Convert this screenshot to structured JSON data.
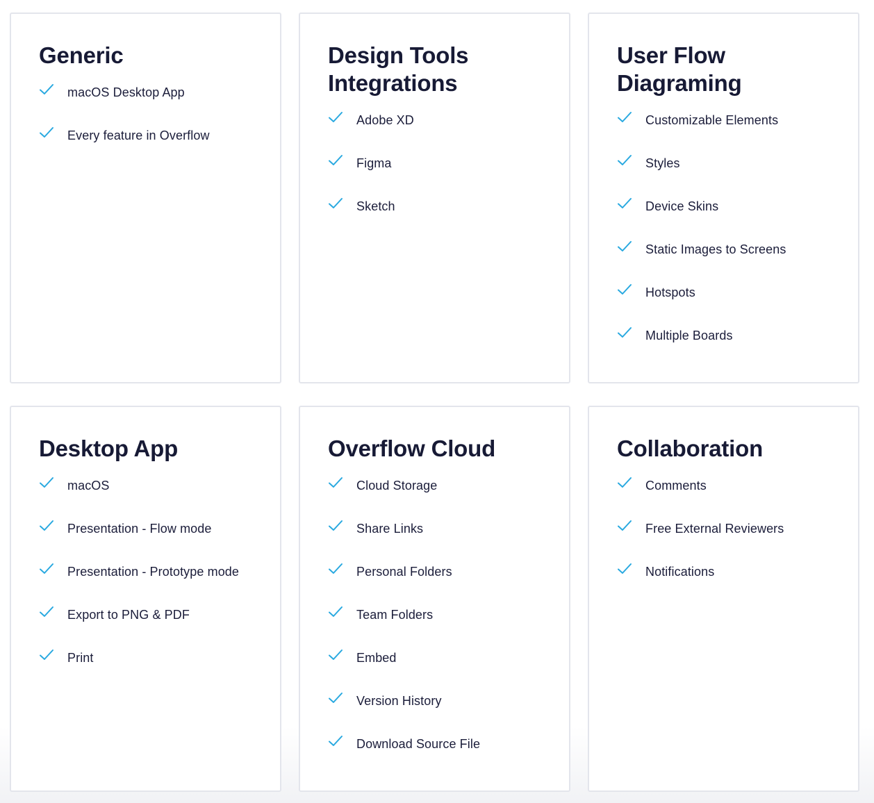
{
  "colors": {
    "check": "#29a9e0",
    "title": "#171a35",
    "text": "#1b1d3a",
    "card_border": "#e3e5ec"
  },
  "icons": {
    "feature_marker": "checkmark-icon"
  },
  "cards": [
    {
      "title": "Generic",
      "features": [
        "macOS Desktop App",
        "Every feature in Overflow"
      ]
    },
    {
      "title": "Design Tools Integrations",
      "features": [
        "Adobe XD",
        "Figma",
        "Sketch"
      ]
    },
    {
      "title": "User Flow Diagraming",
      "features": [
        "Customizable Elements",
        "Styles",
        "Device Skins",
        "Static Images to Screens",
        "Hotspots",
        "Multiple Boards"
      ]
    },
    {
      "title": "Desktop App",
      "features": [
        "macOS",
        "Presentation - Flow mode",
        "Presentation - Prototype mode",
        "Export to PNG & PDF",
        "Print"
      ]
    },
    {
      "title": "Overflow Cloud",
      "features": [
        "Cloud Storage",
        "Share Links",
        "Personal Folders",
        "Team Folders",
        "Embed",
        "Version History",
        "Download Source File"
      ]
    },
    {
      "title": "Collaboration",
      "features": [
        "Comments",
        "Free External Reviewers",
        "Notifications"
      ]
    }
  ]
}
